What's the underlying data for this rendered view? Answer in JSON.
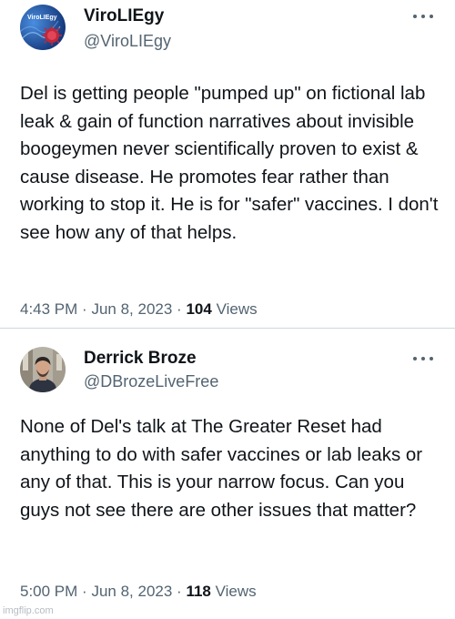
{
  "tweets": [
    {
      "display_name": "ViroLIEgy",
      "handle": "@ViroLIEgy",
      "avatar_label": "ViroLIEgy",
      "text": "Del is getting people \"pumped up\" on fictional lab leak & gain of function narratives about invisible boogeymen never scientifically proven to exist & cause disease. He promotes fear rather than working to stop it. He is for \"safer\" vaccines. I don't see how any of that helps.",
      "time": "4:43 PM",
      "date": "Jun 8, 2023",
      "views_count": "104",
      "views_label": "Views"
    },
    {
      "display_name": "Derrick Broze",
      "handle": "@DBrozeLiveFree",
      "text": "None of Del's talk at The Greater Reset had anything to do with safer vaccines or lab leaks or any of that. This is your narrow focus. Can you guys not see there are other issues that matter?",
      "time": "5:00 PM",
      "date": "Jun 8, 2023",
      "views_count": "118",
      "views_label": "Views"
    }
  ],
  "separator": "·",
  "watermark": "imgflip.com",
  "colors": {
    "text": "#0f1419",
    "secondary": "#536471",
    "divider": "#cfd9de",
    "avatar1_bg": "#1d4fa8",
    "avatar1_virus": "#c2273a"
  }
}
